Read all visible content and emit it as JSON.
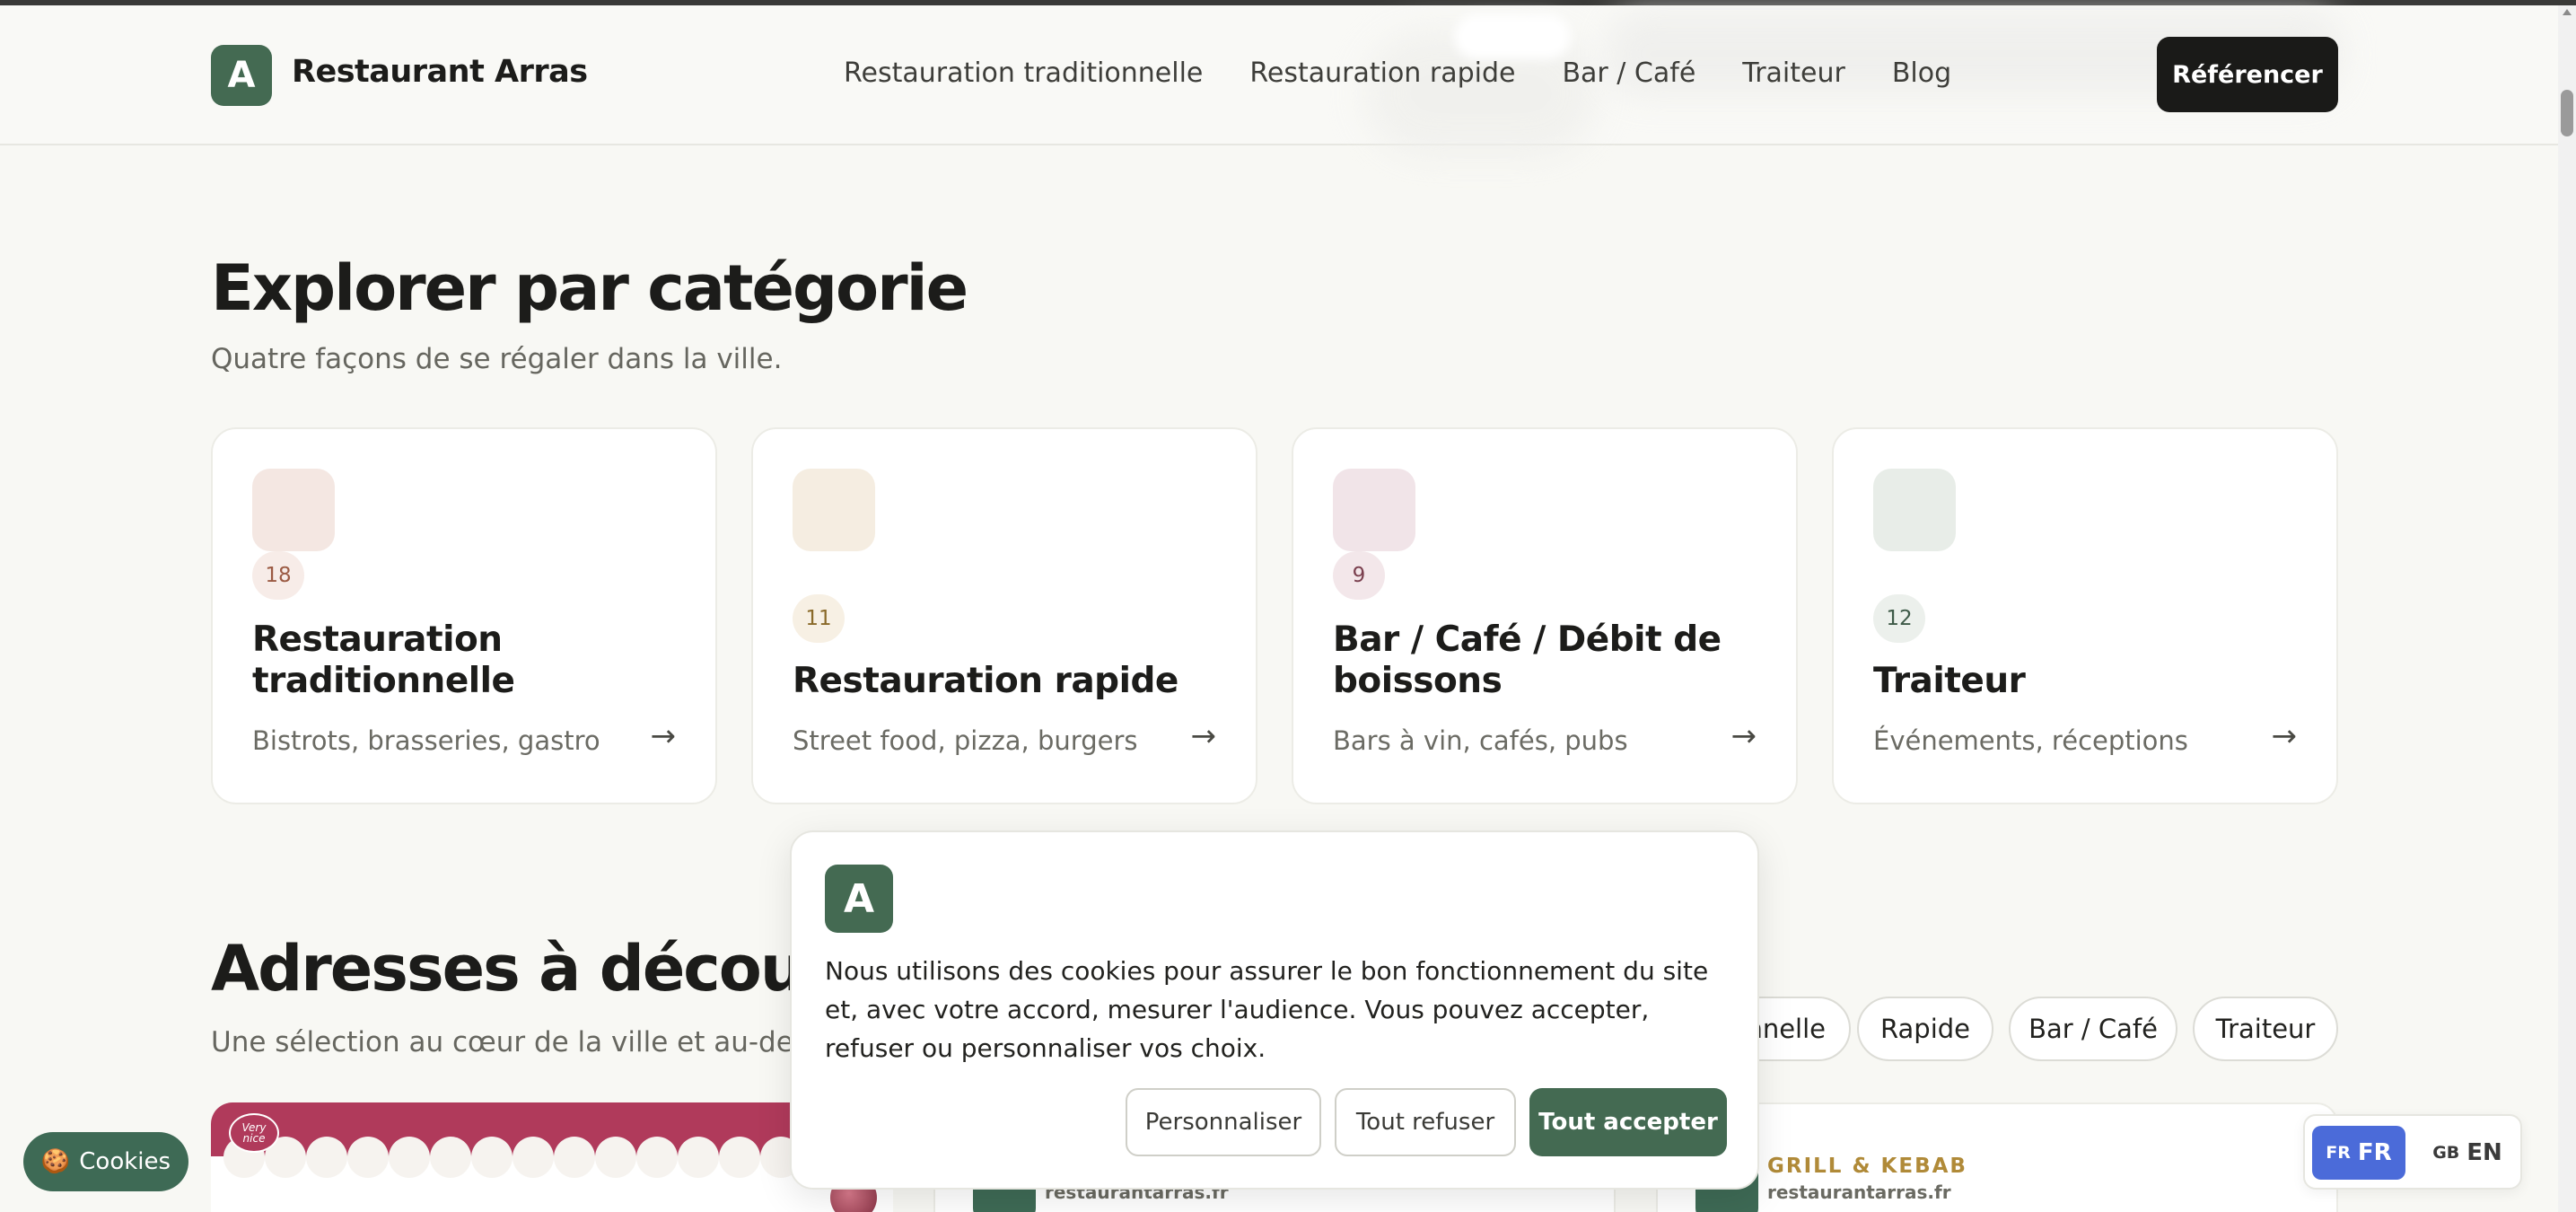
{
  "header": {
    "logo_letter": "A",
    "site_name": "Restaurant Arras",
    "nav": [
      "Restauration traditionnelle",
      "Restauration rapide",
      "Bar / Café",
      "Traiteur",
      "Blog"
    ],
    "cta_label": "Référencer"
  },
  "categories_section": {
    "title": "Explorer par catégorie",
    "subtitle": "Quatre façons de se régaler dans la ville.",
    "cards": [
      {
        "count": "18",
        "title": "Restauration traditionnelle",
        "desc": "Bistrots, brasseries, gastro",
        "arrow": "→",
        "icon_color": "#f4e7e2",
        "badge_bg": "#f7ece8",
        "badge_color": "#9b5a43"
      },
      {
        "count": "11",
        "title": "Restauration rapide",
        "desc": "Street food, pizza, burgers",
        "arrow": "→",
        "icon_color": "#f5ede1",
        "badge_bg": "#f7f0e4",
        "badge_color": "#8a6a2a"
      },
      {
        "count": "9",
        "title": "Bar / Café / Débit de boissons",
        "desc": "Bars à vin, cafés, pubs",
        "arrow": "→",
        "icon_color": "#f1e4e8",
        "badge_bg": "#f3e7ea",
        "badge_color": "#7a3f4e"
      },
      {
        "count": "12",
        "title": "Traiteur",
        "desc": "Événements, réceptions",
        "arrow": "→",
        "icon_color": "#e8ede8",
        "badge_bg": "#ecf0ec",
        "badge_color": "#3e5a48"
      }
    ]
  },
  "addresses_section": {
    "title": "Adresses à découvrir",
    "subtitle": "Une sélection au cœur de la ville et au-delà.",
    "filters": [
      "nnelle",
      "Rapide",
      "Bar / Café",
      "Traiteur"
    ],
    "cards": [
      {
        "badge": "Very nice"
      },
      {
        "domain": "restaurantarras.fr"
      },
      {
        "tag": "GRILL & KEBAB",
        "domain": "restaurantarras.fr"
      }
    ]
  },
  "cookie_modal": {
    "logo_letter": "A",
    "text": "Nous utilisons des cookies pour assurer le bon fonctionnement du site et, avec votre accord, mesurer l'audience. Vous pouvez accepter, refuser ou personnaliser vos choix.",
    "customize_label": "Personnaliser",
    "refuse_label": "Tout refuser",
    "accept_label": "Tout accepter"
  },
  "cookies_button": {
    "icon": "cookie-icon",
    "label": "Cookies"
  },
  "language": {
    "options": [
      {
        "flag": "FR",
        "code": "FR",
        "active": true
      },
      {
        "flag": "GB",
        "code": "EN",
        "active": false
      }
    ]
  },
  "colors": {
    "brand_green": "#446a52",
    "accent_blue": "#4b6bd9",
    "dark_button": "#1a1a18"
  }
}
